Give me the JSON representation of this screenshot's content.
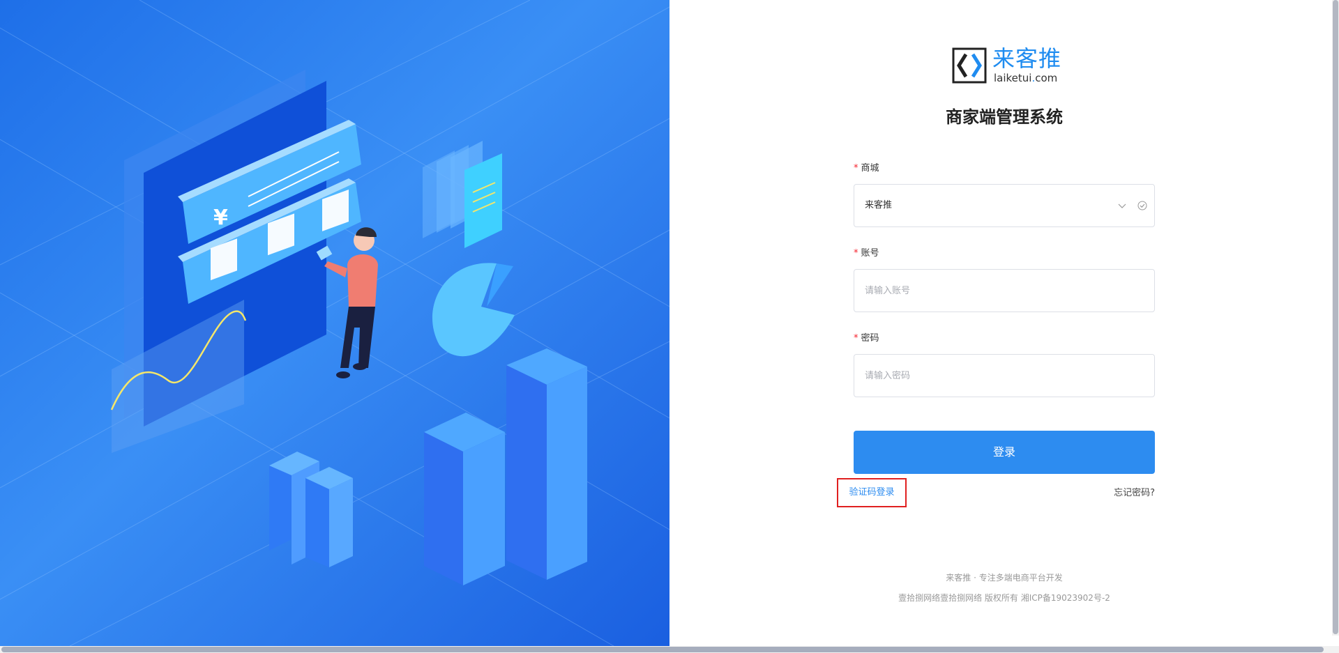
{
  "brand": {
    "name_cn": "来客推",
    "domain_prefix": "laiketui",
    "domain_dot": ".",
    "domain_suffix": "com"
  },
  "title": "商家端管理系统",
  "form": {
    "mall": {
      "label": "商城",
      "value": "来客推"
    },
    "account": {
      "label": "账号",
      "placeholder": "请输入账号"
    },
    "password": {
      "label": "密码",
      "placeholder": "请输入密码"
    },
    "required_mark": "*",
    "login_label": "登录",
    "sms_login_label": "验证码登录",
    "forgot_label": "忘记密码?"
  },
  "footer": {
    "line1": "来客推 · 专注多端电商平台开发",
    "line2": "壹拾捌网络壹拾捌网络 版权所有 湘ICP备19023902号-2"
  },
  "illustration": {
    "currency_symbol": "¥"
  },
  "colors": {
    "accent": "#2d8cf0",
    "required": "#f5222d",
    "highlight_box": "#e02020",
    "panel_blue": "#1e6fe8"
  }
}
